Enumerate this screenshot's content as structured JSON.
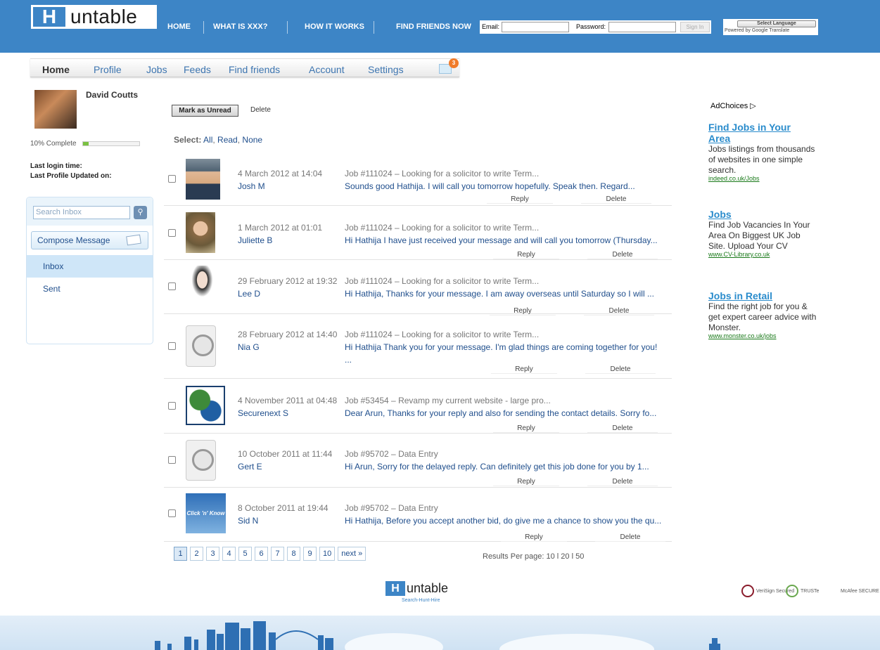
{
  "brand": {
    "logo_letter": "H",
    "logo_text": "untable",
    "tagline": "Search-Hunt-Hire"
  },
  "topnav": [
    "HOME",
    "WHAT IS XXX?",
    "HOW IT WORKS",
    "FIND FRIENDS NOW"
  ],
  "login": {
    "email_label": "Email:",
    "password_label": "Password:",
    "signin": "Sign In"
  },
  "translate": {
    "select": "Select Language",
    "powered": "Powered by Google Translate"
  },
  "subnav": [
    "Home",
    "Profile",
    "Jobs",
    "Feeds",
    "Find friends",
    "Account",
    "Settings"
  ],
  "mail_badge": "3",
  "user": {
    "name": "David Coutts",
    "complete_label": "10% Complete",
    "complete_fraction": 0.1,
    "last_login": "Last login time:",
    "last_updated": "Last Profile Updated on:"
  },
  "sidebar": {
    "search_placeholder": "Search Inbox",
    "compose": "Compose Message",
    "inbox": "Inbox",
    "sent": "Sent"
  },
  "toolbar": {
    "mark_unread": "Mark as Unread",
    "delete": "Delete"
  },
  "select": {
    "label": "Select:",
    "all": "All",
    "read": "Read",
    "none": "None"
  },
  "messages": [
    {
      "date": "4 March 2012 at 14:04",
      "sender": "Josh M",
      "subject": "Job #111024 – Looking for a solicitor to write Term...",
      "preview": "Sounds good Hathija. I will call you tomorrow hopefully. Speak then. Regard...",
      "preview2": "",
      "reply": "Reply",
      "delete": "Delete",
      "avatar": "photo-josh"
    },
    {
      "date": "1 March 2012 at 01:01",
      "sender": "Juliette B",
      "subject": "Job #111024 – Looking for a solicitor to write Term...",
      "preview": "Hi Hathija I have just received your message and will call you tomorrow (Thursday...",
      "preview2": "",
      "reply": "Reply",
      "delete": "Delete",
      "avatar": "photo-juliette"
    },
    {
      "date": "29 February 2012 at 19:32",
      "sender": "Lee D",
      "subject": "Job #111024 – Looking for a solicitor to write Term...",
      "preview": "Hi Hathija, Thanks for your message. I am away overseas until Saturday so I will ...",
      "preview2": "",
      "reply": "Reply",
      "delete": "Delete",
      "avatar": "photo-lee"
    },
    {
      "date": "28 February 2012 at 14:40",
      "sender": "Nia G",
      "subject": "Job #111024 – Looking for a solicitor to write Term...",
      "preview": "Hi Hathija Thank you for your message. I'm glad things are coming together for you!",
      "preview2": "...",
      "reply": "Reply",
      "delete": "Delete",
      "avatar": "default-avatar"
    },
    {
      "date": "4 November 2011 at 04:48",
      "sender": "Securenext S",
      "subject": "Job #53454 – Revamp my current website - large pro...",
      "preview": "Dear Arun, Thanks for your reply and also for sending the contact details. Sorry fo...",
      "preview2": "",
      "reply": "Reply",
      "delete": "Delete",
      "avatar": "securenext-logo"
    },
    {
      "date": "10 October 2011 at 11:44",
      "sender": "Gert E",
      "subject": "Job #95702 – Data Entry",
      "preview": "Hi Arun, Sorry for the delayed reply. Can definitely get this job done for you by 1...",
      "preview2": "",
      "reply": "Reply",
      "delete": "Delete",
      "avatar": "default-avatar"
    },
    {
      "date": "8 October 2011 at 19:44",
      "sender": "Sid N",
      "subject": "Job #95702 – Data Entry",
      "preview": "Hi Hathija, Before you accept another bid, do give me a chance to show you the qu...",
      "preview2": "",
      "reply": "Reply",
      "delete": "Delete",
      "avatar": "click-n-know-logo",
      "avatar_text": "Click 'n' Know"
    }
  ],
  "pagination": {
    "pages": [
      "1",
      "2",
      "3",
      "4",
      "5",
      "6",
      "7",
      "8",
      "9",
      "10"
    ],
    "next": "next »",
    "current": "1"
  },
  "per_page": "Results Per page:  10 l 20 l 50",
  "ads": {
    "adchoices": "AdChoices",
    "items": [
      {
        "title": "Find Jobs in Your Area",
        "body": "Jobs listings from thousands of websites in one simple search.",
        "url": "indeed.co.uk/Jobs"
      },
      {
        "title": "Jobs",
        "body": "Find Job Vacancies In Your Area On Biggest UK Job Site. Upload Your CV",
        "url": "www.CV-Library.co.uk"
      },
      {
        "title": "Jobs in Retail",
        "body": "Find the right job for you & get expert career advice with Monster.",
        "url": "www.monster.co.uk/jobs"
      }
    ]
  },
  "seals": [
    "VeriSign Secured",
    "TRUSTe",
    "McAfee SECURE"
  ],
  "colors": {
    "header_blue": "#3d85c6",
    "link_blue": "#1f4e8c",
    "ad_title": "#2a8ccc",
    "ad_url": "#1a7a1a",
    "badge": "#f07b2a",
    "progress": "#7ac142"
  }
}
